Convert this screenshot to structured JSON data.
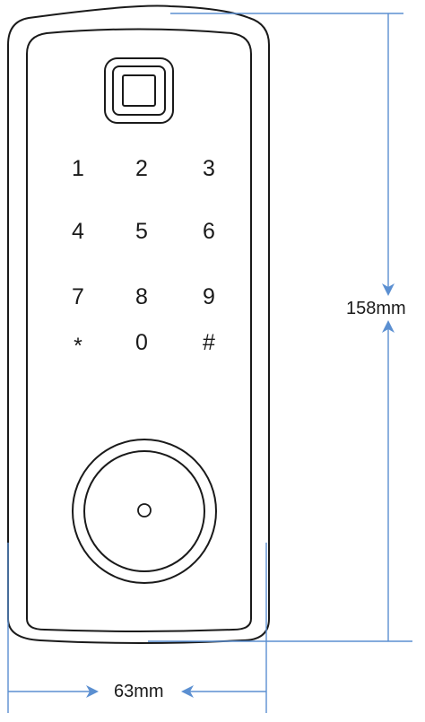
{
  "keypad": {
    "keys": [
      "1",
      "2",
      "3",
      "4",
      "5",
      "6",
      "7",
      "8",
      "9",
      "*",
      "0",
      "#"
    ]
  },
  "dimensions": {
    "height_label": "158mm",
    "width_label": "63mm",
    "line_color": "#5b8fd1"
  },
  "icons": {
    "fingerprint_sensor": "fingerprint-sensor-icon",
    "knob_indicator": "knob-indicator-icon"
  }
}
